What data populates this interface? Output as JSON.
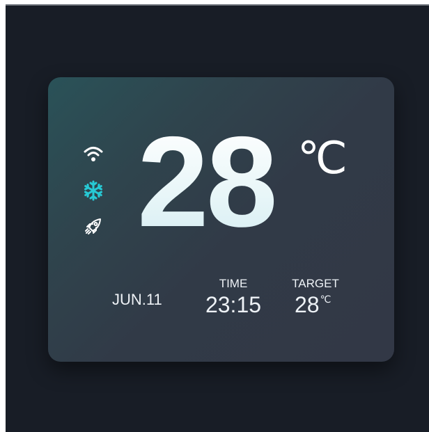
{
  "thermostat": {
    "temperature": "28",
    "unit": "℃",
    "date": "JUN.11",
    "time_label": "TIME",
    "time": "23:15",
    "target_label": "TARGET",
    "target_temp": "28",
    "target_unit": "℃"
  },
  "status_icons": [
    {
      "name": "wifi-icon",
      "color": "#ffffff"
    },
    {
      "name": "snowflake-icon",
      "color": "#27c9d4"
    },
    {
      "name": "rocket-icon",
      "color": "#ffffff"
    }
  ],
  "colors": {
    "background": "#181d26",
    "card": "#313a47",
    "card_accent": "#2a5258",
    "text": "#eef2f6",
    "cool_accent": "#27c9d4"
  }
}
